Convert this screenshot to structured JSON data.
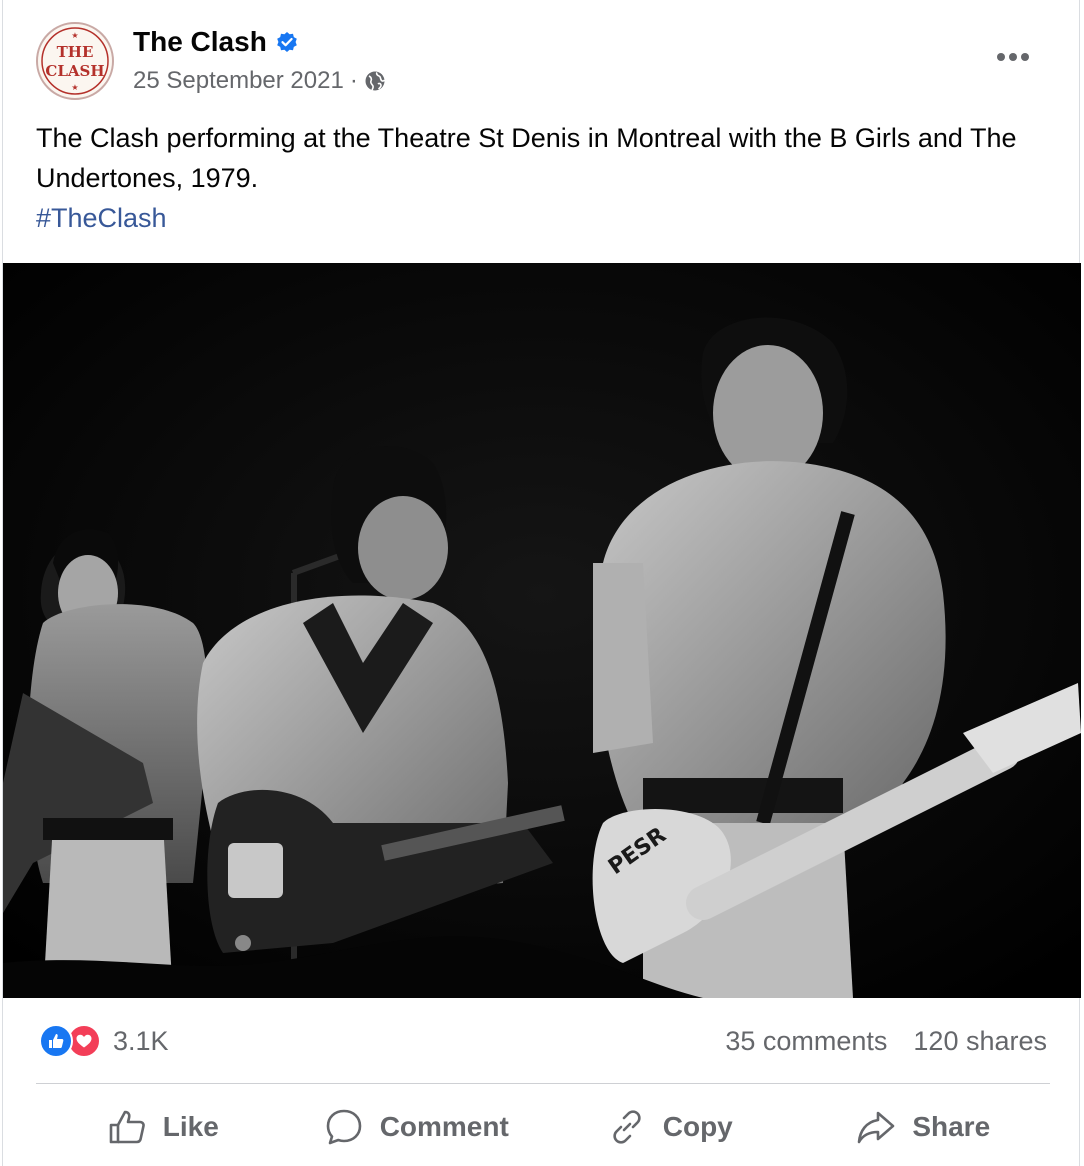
{
  "post": {
    "page_name": "The Clash",
    "date": "25 September 2021",
    "dot": "·",
    "avatar_text_top": "THE",
    "avatar_text_bottom": "CLASH",
    "caption": "The Clash performing at the Theatre St Denis in Montreal with the B Girls and The Undertones, 1979.",
    "hashtag": "#TheClash",
    "photo_guitar_lettering": "PESR"
  },
  "stats": {
    "reaction_count": "3.1K",
    "comments": "35 comments",
    "shares": "120 shares"
  },
  "actions": {
    "like": "Like",
    "comment": "Comment",
    "copy": "Copy",
    "share": "Share"
  },
  "colors": {
    "accent_blue": "#1877f2",
    "hashtag_blue": "#385898",
    "love_red": "#f33e58",
    "secondary_text": "#65676b",
    "avatar_red": "#b4312b"
  },
  "icons": {
    "verified": "verified-badge-icon",
    "audience": "globe-icon",
    "more": "more-dots-icon",
    "like": "thumbs-up-icon",
    "love": "heart-icon",
    "comment": "speech-bubble-icon",
    "copy": "link-icon",
    "share": "share-arrow-icon"
  }
}
